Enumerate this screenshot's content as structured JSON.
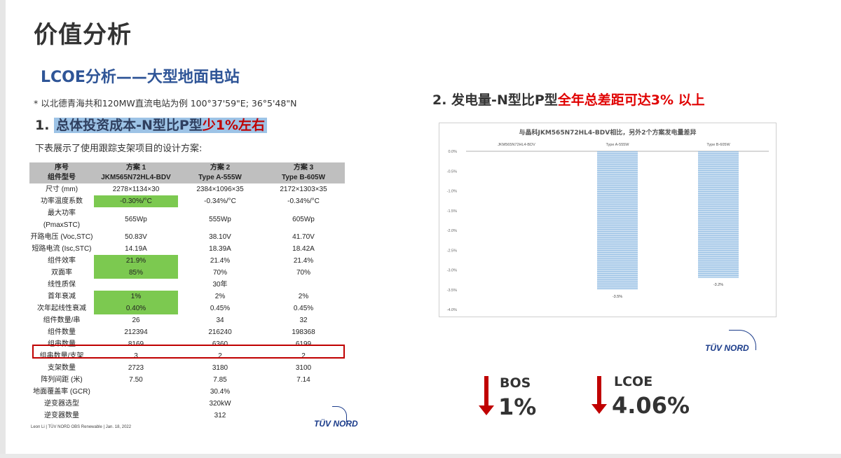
{
  "title": "价值分析",
  "subtitle": "LCOE分析——大型地面电站",
  "note": "* 以北德青海共和120MW直流电站为例 100°37'59\"E; 36°5'48\"N",
  "section1": {
    "num": "1.",
    "hl": "总体投资成本-N型比P型",
    "red": "少1%左右"
  },
  "desc": "下表展示了使用跟踪支架项目的设计方案:",
  "table": {
    "headers": [
      [
        "序号",
        "组件型号"
      ],
      [
        "方案 1",
        "JKM565N72HL4-BDV"
      ],
      [
        "方案 2",
        "Type A-555W"
      ],
      [
        "方案 3",
        "Type B-605W"
      ]
    ],
    "rows": [
      [
        "尺寸 (mm)",
        "2278×1134×30",
        "2384×1096×35",
        "2172×1303×35"
      ],
      [
        "功率温度系数",
        "-0.30%/°C",
        "-0.34%/°C",
        "-0.34%/°C"
      ],
      [
        "最大功率 (PmaxSTC)",
        "565Wp",
        "555Wp",
        "605Wp"
      ],
      [
        "开路电压 (Voc,STC)",
        "50.83V",
        "38.10V",
        "41.70V"
      ],
      [
        "短路电流 (Isc,STC)",
        "14.19A",
        "18.39A",
        "18.42A"
      ],
      [
        "组件效率",
        "21.9%",
        "21.4%",
        "21.4%"
      ],
      [
        "双面率",
        "85%",
        "70%",
        "70%"
      ],
      [
        "线性质保",
        "",
        "30年",
        ""
      ],
      [
        "首年衰减",
        "1%",
        "2%",
        "2%"
      ],
      [
        "次年起线性衰减",
        "0.40%",
        "0.45%",
        "0.45%"
      ],
      [
        "组件数量/串",
        "26",
        "34",
        "32"
      ],
      [
        "组件数量",
        "212394",
        "216240",
        "198368"
      ],
      [
        "组串数量",
        "8169",
        "6360",
        "6199"
      ],
      [
        "组串数量/支架",
        "3",
        "2",
        "2"
      ],
      [
        "支架数量",
        "2723",
        "3180",
        "3100"
      ],
      [
        "阵列间距 (米)",
        "7.50",
        "7.85",
        "7.14"
      ],
      [
        "地面覆盖率 (GCR)",
        "",
        "30.4%",
        ""
      ],
      [
        "逆变器选型",
        "",
        "320kW",
        ""
      ],
      [
        "逆变器数量",
        "",
        "312",
        ""
      ]
    ],
    "highlight_cells": [
      [
        1,
        1
      ],
      [
        5,
        1
      ],
      [
        6,
        1
      ],
      [
        8,
        1
      ],
      [
        9,
        1
      ]
    ],
    "highlight_color": "#7cc950",
    "boxed_row_color": "#c00000"
  },
  "footer": "Leon Li | TÜV NORD OBS Renewable | Jan. 18, 2022",
  "logo_text": "TÜV NORD",
  "section2": {
    "head": "2. 发电量-N型比P型",
    "red": "全年总差距可达3% 以上"
  },
  "chart_data": {
    "type": "bar",
    "title": "与晶科JKM565N72HL4-BDV相比，另外2个方案发电量差异",
    "categories": [
      "JKM565N72HL4-BDV",
      "Type A-555W",
      "Type B-605W"
    ],
    "values": [
      0,
      -3.5,
      -3.2
    ],
    "data_labels": [
      "",
      "-3.5%",
      "-3.2%"
    ],
    "ylim": [
      -4.0,
      0.0
    ],
    "yticks": [
      "0.0%",
      "-0.5%",
      "-1.0%",
      "-1.5%",
      "-2.0%",
      "-2.5%",
      "-3.0%",
      "-3.5%",
      "-4.0%"
    ],
    "bar_color": "#9dc3e6"
  },
  "kpis": [
    {
      "label": "BOS",
      "value": "1%"
    },
    {
      "label": "LCOE",
      "value": "4.06%"
    }
  ],
  "colors": {
    "accent_blue": "#2f5597",
    "red": "#c00000",
    "green": "#7cc950"
  }
}
